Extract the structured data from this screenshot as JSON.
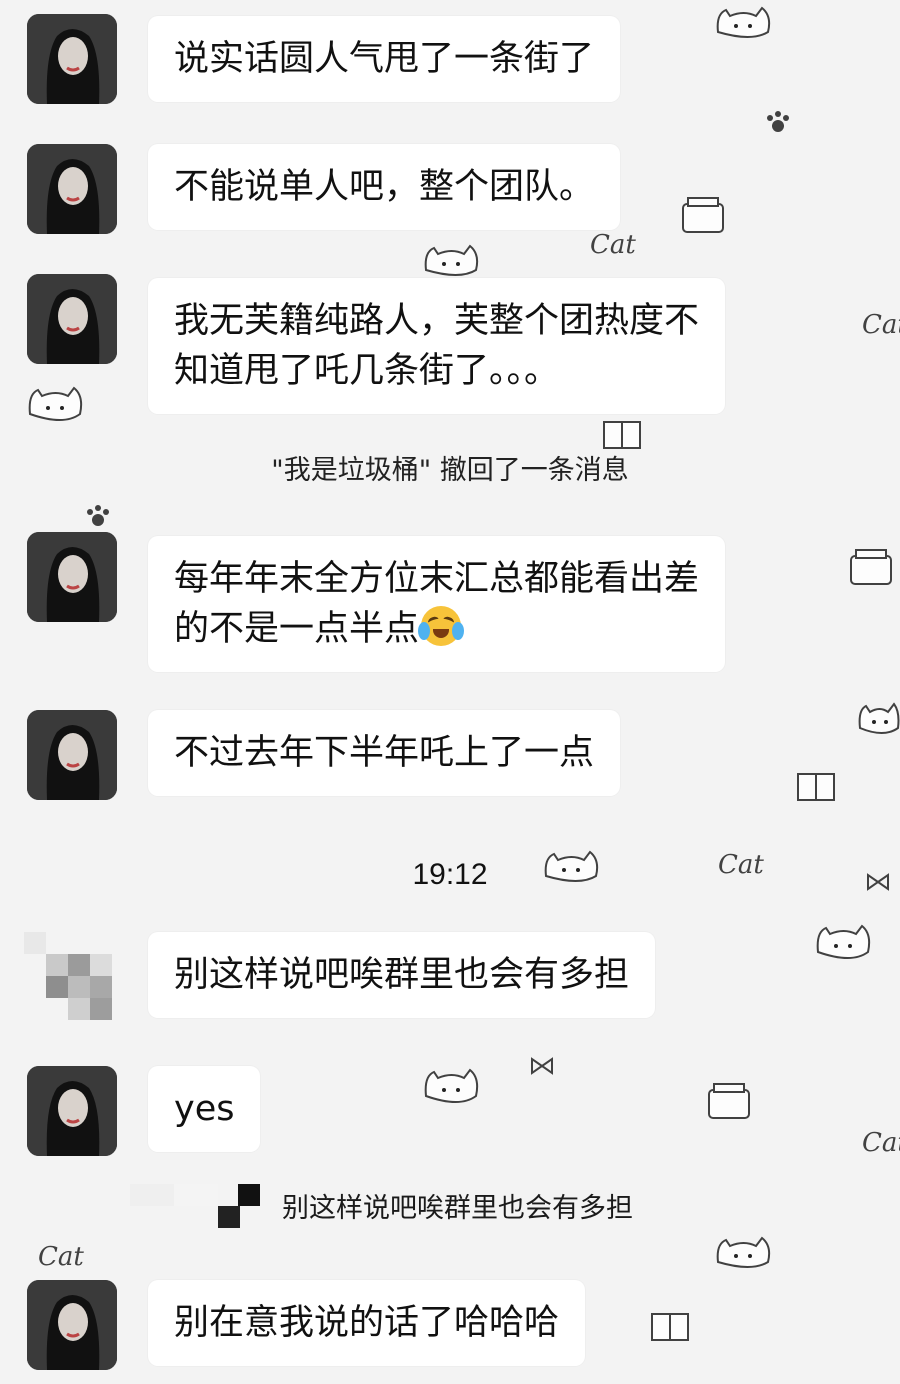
{
  "messages": [
    {
      "sender": "avatar_woman",
      "lines": [
        "说实话圆人气甩了一条街了"
      ]
    },
    {
      "sender": "avatar_woman",
      "lines": [
        "不能说单人吧，整个团队。"
      ]
    },
    {
      "sender": "avatar_woman",
      "lines": [
        "我无芙籍纯路人，芙整个团热度不",
        "知道甩了吒几条街了。。。"
      ]
    },
    {
      "sender": "avatar_woman",
      "lines": [
        "每年年末全方位末汇总都能看出差",
        "的不是一点半点"
      ],
      "trailing_emoji": "loudly-crying-face-icon"
    },
    {
      "sender": "avatar_woman",
      "lines": [
        "不过去年下半年吒上了一点"
      ]
    },
    {
      "sender": "mosaic_user",
      "lines": [
        "别这样说吧唉群里也会有多担"
      ]
    },
    {
      "sender": "avatar_woman",
      "lines": [
        "yes"
      ]
    },
    {
      "sender": "avatar_woman",
      "lines": [
        "别在意我说的话了哈哈哈"
      ]
    }
  ],
  "system_note": "\"我是垃圾桶\" 撤回了一条消息",
  "timestamp": "19:12",
  "quoted_reply": {
    "text": "别这样说吧唉群里也会有多担"
  },
  "background_doodles": {
    "word": "Cat",
    "colors": {
      "bubble": "#ffffff",
      "background": "#f3f3f3"
    }
  }
}
